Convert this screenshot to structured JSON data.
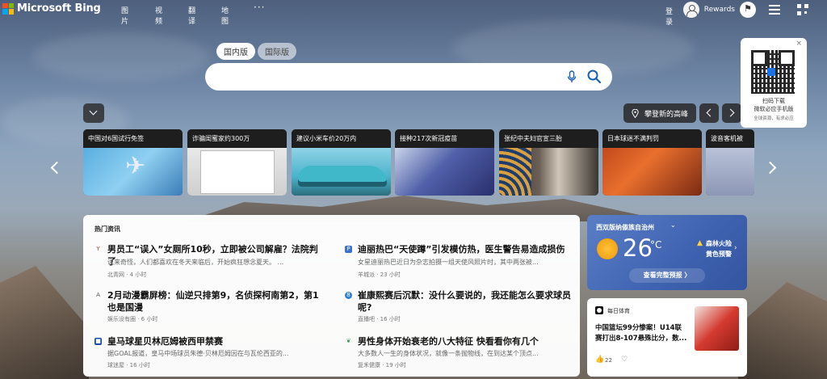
{
  "brand": {
    "name": "Microsoft Bing"
  },
  "nav": {
    "items": [
      "图片",
      "视频",
      "翻译",
      "地图",
      "···"
    ]
  },
  "top_right": {
    "login": "登录",
    "rewards": "Rewards"
  },
  "search": {
    "tabs": [
      "国内版",
      "国际版"
    ],
    "value": "",
    "placeholder": ""
  },
  "location": {
    "label": "攀登新的高峰"
  },
  "qr": {
    "close": "×",
    "line1": "扫码下载",
    "line2": "微软必应手机版",
    "line3": "全球资源，有求必应"
  },
  "carousel": [
    {
      "caption": "中国对6国试行免签"
    },
    {
      "caption": "诈骗闺蜜家约300万"
    },
    {
      "caption": "建议小米车价20万内"
    },
    {
      "caption": "接种217次新冠疫苗"
    },
    {
      "caption": "张纪中夫妇官宣三胎"
    },
    {
      "caption": "日本球迷不满判罚"
    },
    {
      "caption": "波音客机被"
    }
  ],
  "news": {
    "title": "热门资讯",
    "items": [
      {
        "headline": "男员工“误入”女厕所10秒，立即被公司解雇？法院判了",
        "snippet": "说来奇怪，人们都喜欢在冬天来临后，开始疯狂想念夏天。 ...",
        "meta": "北青网 · 4 小时"
      },
      {
        "headline": "迪丽热巴“天使蹲”引发模仿热，医生警告易造成损伤",
        "snippet": "女星迪丽热巴近日为杂志拍摄一组天使风照片时，其中两张被...",
        "meta": "羊城派 · 23 小时"
      },
      {
        "headline": "2月动漫霸屏榜：仙逆只排第9，名侦探柯南第2，第1也是国漫",
        "snippet": "",
        "meta": "娱乐没有圈 · 6 小时"
      },
      {
        "headline": "崔康熙赛后沉默：没什么要说的，我还能怎么要求球员呢?",
        "snippet": "",
        "meta": "直播吧 · 16 小时"
      },
      {
        "headline": "皇马球星贝林厄姆被西甲禁赛",
        "snippet": "据GOAL报道，皇马中场球员朱德·贝林厄姆因在与瓦伦西亚的...",
        "meta": "球迷屋 · 16 小时"
      },
      {
        "headline": "男性身体开始衰老的八大特征 快看看你有几个",
        "snippet": "大多数人一生的身体状况，就像一条抛物线，在到达某个顶点...",
        "meta": "复禾健康 · 19 小时"
      }
    ]
  },
  "weather": {
    "location": "西双版纳傣族自治州",
    "temp": "26",
    "unit": "°C",
    "warning_line1": "森林火险",
    "warning_line2": "黄色预警",
    "forecast_button": "查看完整预报 〉"
  },
  "sports": {
    "source": "每日体育",
    "headline_line1": "中国篮坛99分惨案！U14联",
    "headline_line2": "赛打出8-107悬殊比分，数...",
    "likes": "22"
  },
  "colors": {
    "weather_bg": "#3e62b0",
    "brand_red": "#f25022",
    "brand_green": "#7fba00",
    "brand_blue": "#00a4ef",
    "brand_yellow": "#ffb900"
  }
}
